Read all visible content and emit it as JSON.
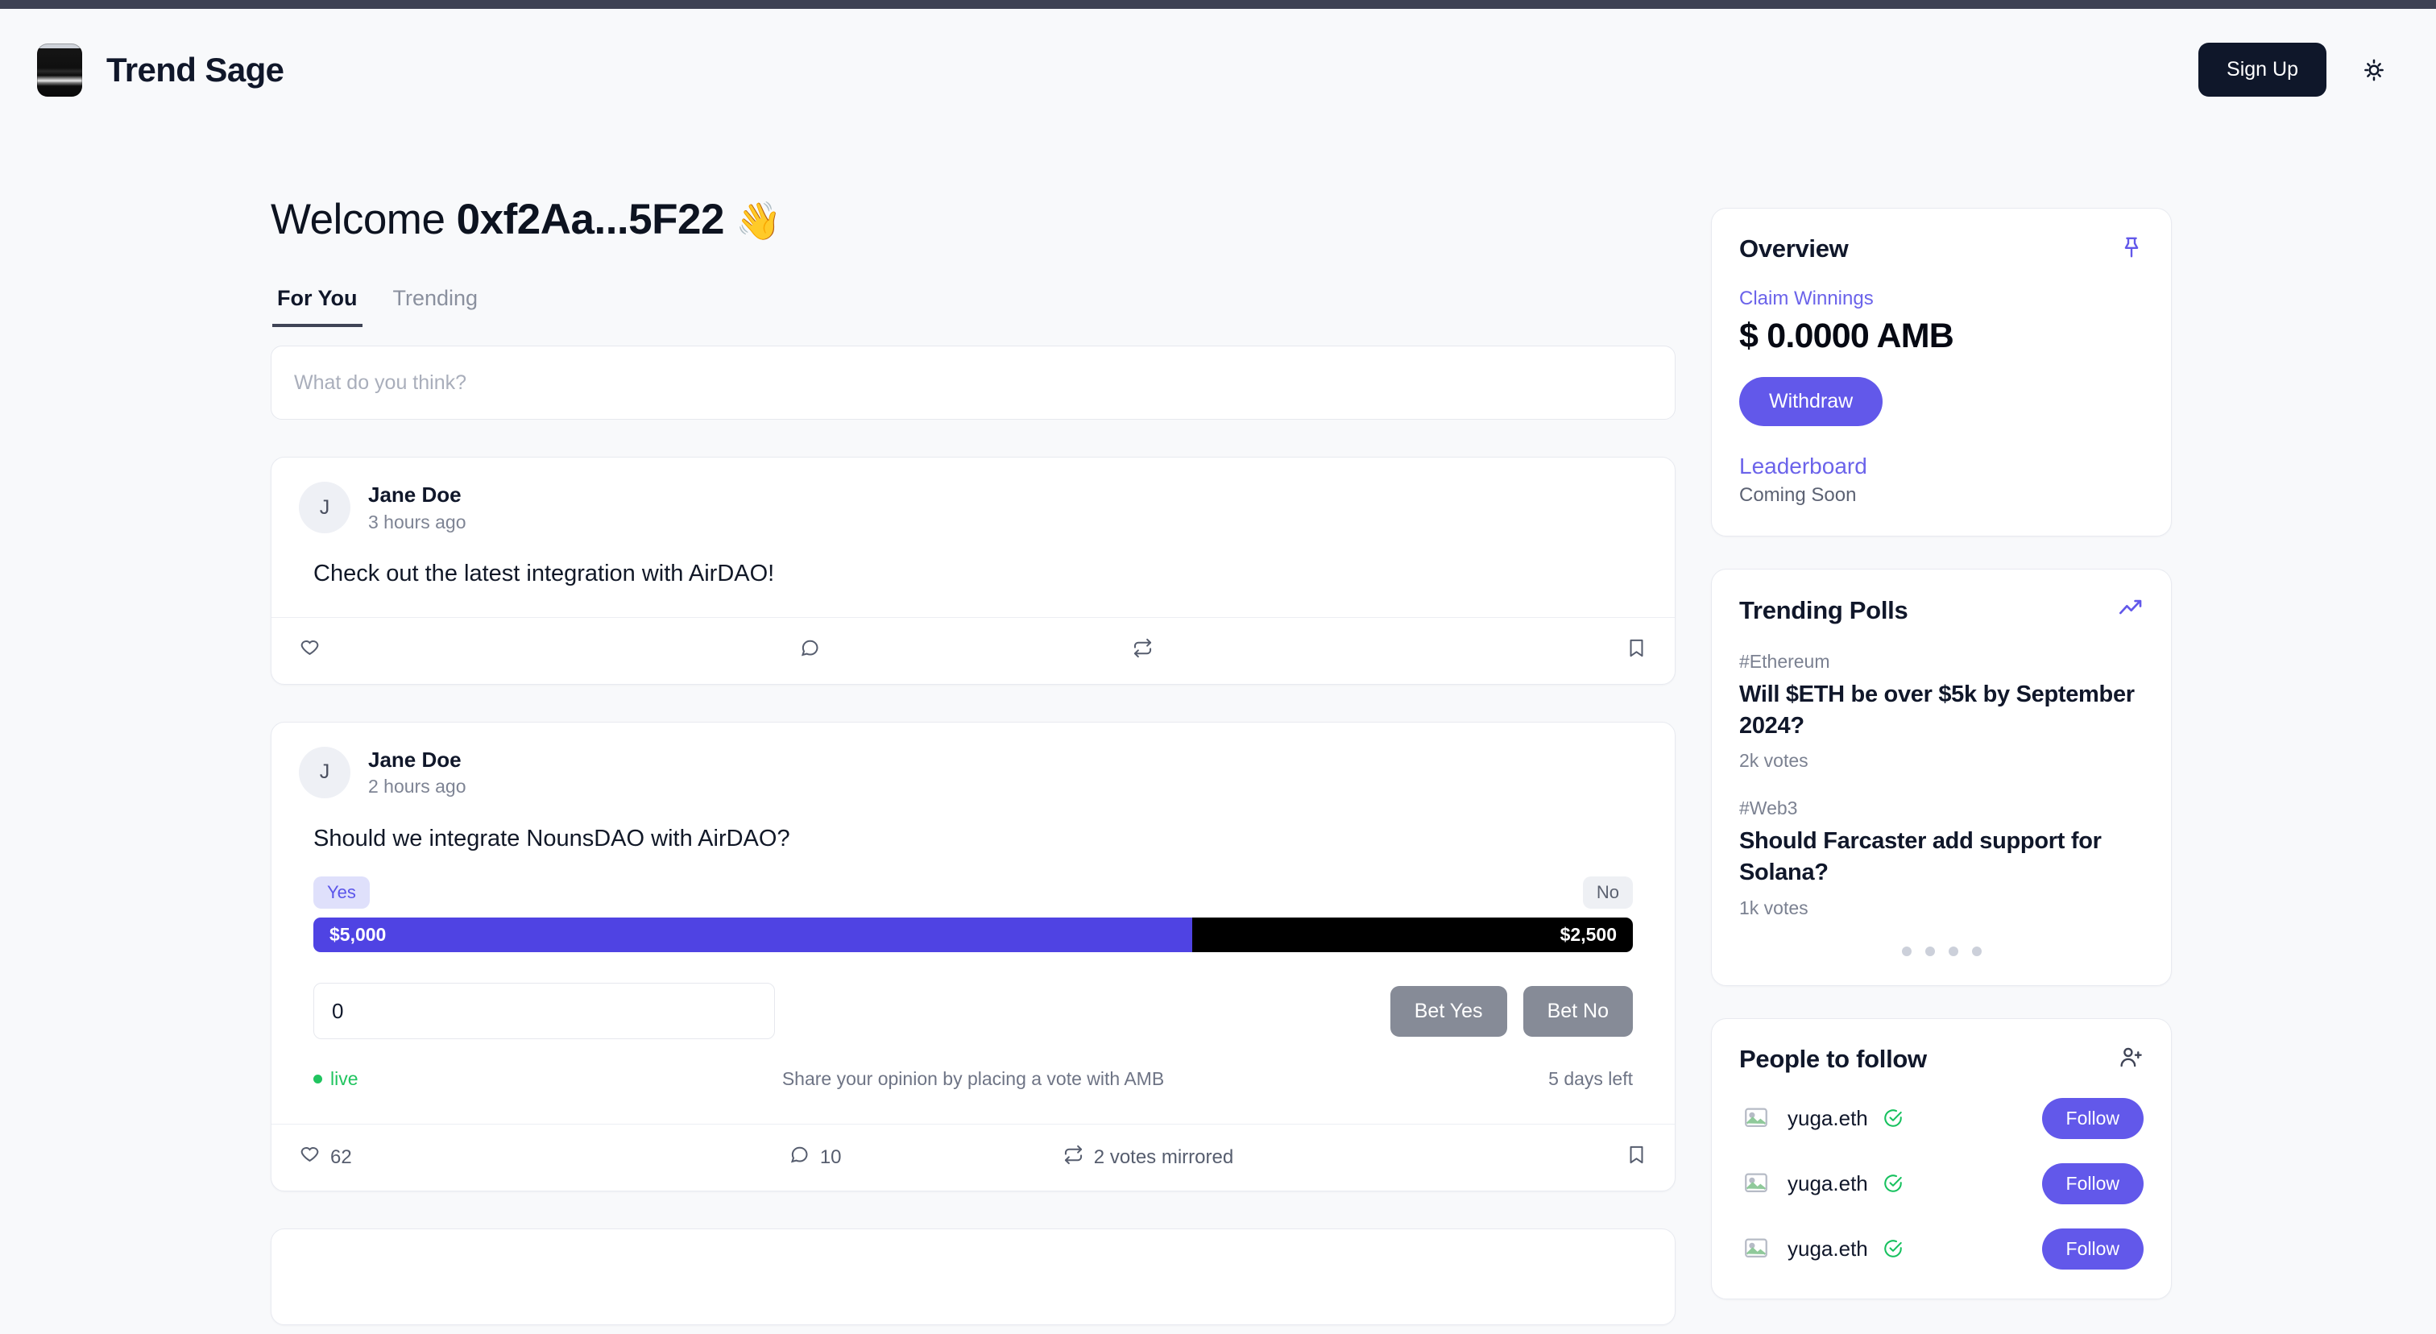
{
  "header": {
    "brand_name": "Trend Sage",
    "logo_icon": "app-logo",
    "signup_label": "Sign Up",
    "theme_icon": "sun-icon"
  },
  "welcome": {
    "prefix": "Welcome",
    "address": "0xf2Aa...5F22",
    "wave_emoji": "👋"
  },
  "tabs": [
    {
      "label": "For You",
      "active": true
    },
    {
      "label": "Trending",
      "active": false
    }
  ],
  "composer": {
    "placeholder": "What do you think?",
    "value": ""
  },
  "posts": [
    {
      "avatar_initial": "J",
      "author": "Jane Doe",
      "time": "3 hours ago",
      "text": "Check out the latest integration with AirDAO!",
      "actions": {
        "like_icon": "heart-icon",
        "like_count": "",
        "comment_icon": "comment-icon",
        "comment_count": "",
        "repost_icon": "repost-icon",
        "repost_count": "",
        "bookmark_icon": "bookmark-icon"
      }
    },
    {
      "avatar_initial": "J",
      "author": "Jane Doe",
      "time": "2 hours ago",
      "text": "Should we integrate NounsDAO with AirDAO?",
      "poll": {
        "yes_label": "Yes",
        "no_label": "No",
        "yes_amount": "$5,000",
        "no_amount": "$2,500",
        "yes_pct": 66.6,
        "no_pct": 33.4,
        "bet_input_value": "0",
        "bet_yes_label": "Bet Yes",
        "bet_no_label": "Bet No",
        "status": "live",
        "hint": "Share your opinion by placing a vote with AMB",
        "time_left": "5 days left"
      },
      "actions": {
        "like_icon": "heart-icon",
        "like_count": "62",
        "comment_icon": "comment-icon",
        "comment_count": "10",
        "repost_icon": "repost-icon",
        "repost_count": "2 votes mirrored",
        "bookmark_icon": "bookmark-icon"
      }
    }
  ],
  "overview": {
    "title": "Overview",
    "pin_icon": "pin-icon",
    "claim_label": "Claim Winnings",
    "amount": "$ 0.0000 AMB",
    "withdraw_label": "Withdraw",
    "leaderboard_label": "Leaderboard",
    "leaderboard_status": "Coming Soon"
  },
  "trending": {
    "title": "Trending Polls",
    "trend_icon": "trending-up-icon",
    "items": [
      {
        "tag": "#Ethereum",
        "question": "Will $ETH be over $5k by September 2024?",
        "votes": "2k votes"
      },
      {
        "tag": "#Web3",
        "question": "Should Farcaster add support for Solana?",
        "votes": "1k votes"
      }
    ],
    "dots": 4
  },
  "people": {
    "title": "People to follow",
    "add_icon": "user-plus-icon",
    "items": [
      {
        "name": "yuga.eth",
        "verified_icon": "verified-check-icon",
        "follow_label": "Follow",
        "avatar_icon": "broken-image-icon"
      },
      {
        "name": "yuga.eth",
        "verified_icon": "verified-check-icon",
        "follow_label": "Follow",
        "avatar_icon": "broken-image-icon"
      },
      {
        "name": "yuga.eth",
        "verified_icon": "verified-check-icon",
        "follow_label": "Follow",
        "avatar_icon": "broken-image-icon"
      }
    ]
  },
  "colors": {
    "accent_indigo": "#6258ea",
    "bar_yes": "#4f43e3",
    "bar_no": "#000000",
    "live_green": "#20c45f",
    "dark_navy": "#0f172a",
    "page_bg": "#f8f9fb",
    "top_strip": "#3e4254"
  }
}
